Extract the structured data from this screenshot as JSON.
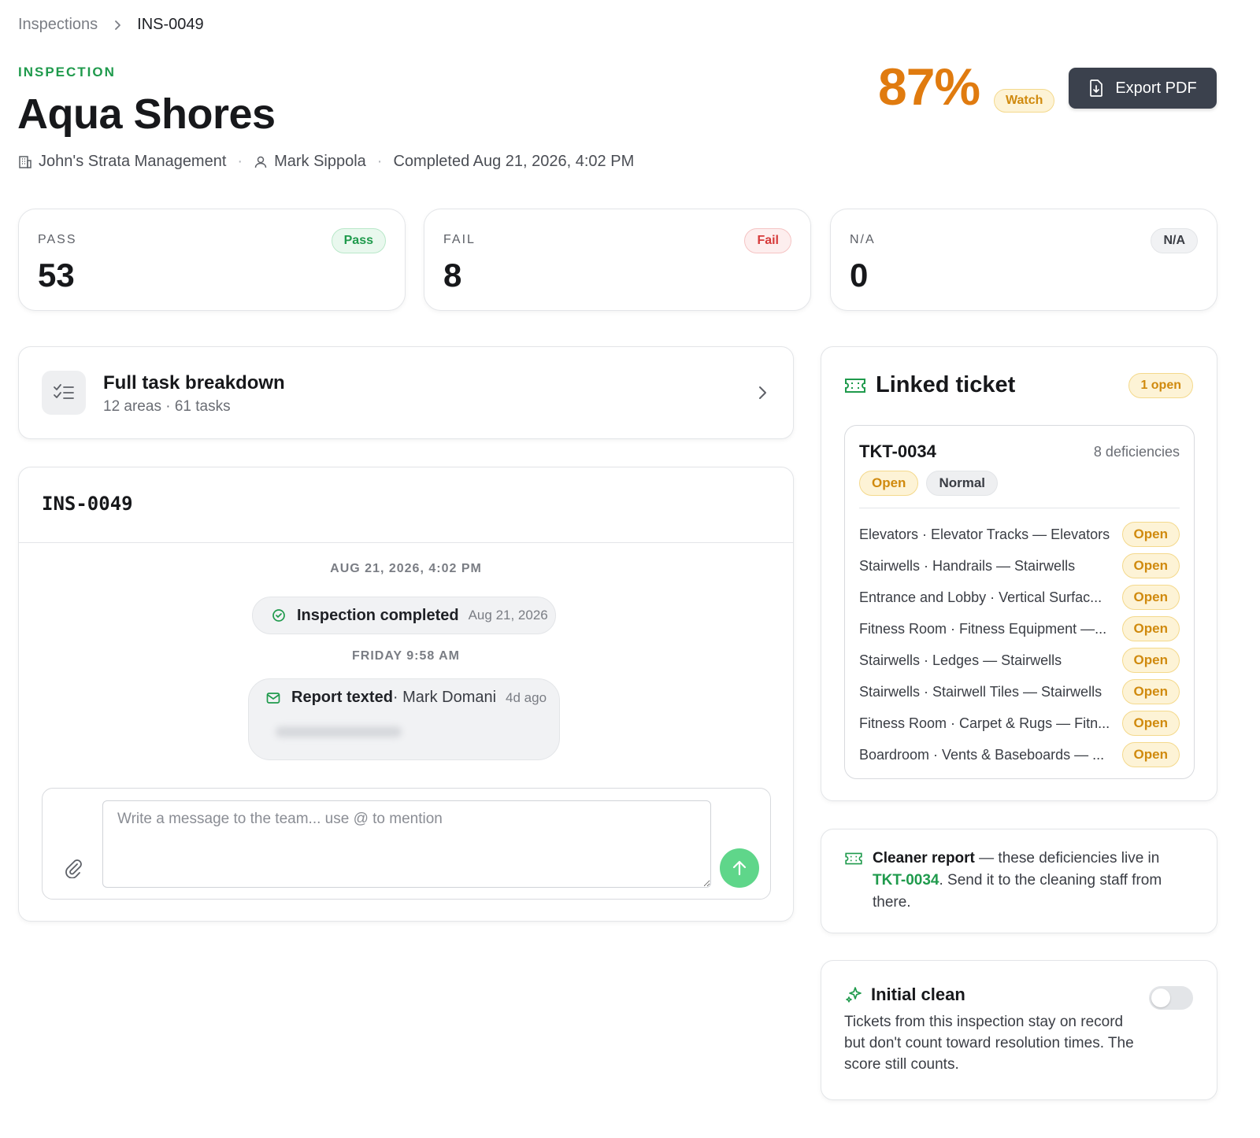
{
  "breadcrumb": {
    "parent": "Inspections",
    "current": "INS-0049"
  },
  "header": {
    "eyebrow": "INSPECTION",
    "title": "Aqua Shores",
    "company": "John's Strata Management",
    "inspector": "Mark Sippola",
    "completed": "Completed Aug 21, 2026, 4:02 PM",
    "score": "87%",
    "score_badge": "Watch",
    "export_label": "Export PDF"
  },
  "stats": [
    {
      "label": "PASS",
      "value": "53",
      "badge": "Pass"
    },
    {
      "label": "FAIL",
      "value": "8",
      "badge": "Fail"
    },
    {
      "label": "N/A",
      "value": "0",
      "badge": "N/A"
    }
  ],
  "breakdown": {
    "title": "Full task breakdown",
    "subtitle": "12 areas · 61 tasks"
  },
  "activity": {
    "id": "INS-0049",
    "day1": "AUG 21, 2026, 4:02 PM",
    "event1": {
      "title": "Inspection completed",
      "date": "Aug 21, 2026"
    },
    "day2": "FRIDAY 9:58 AM",
    "event2": {
      "title": "Report texted",
      "by": "· Mark Domani",
      "ago": "4d ago"
    },
    "composer_placeholder": "Write a message to the team... use @ to mention"
  },
  "linked": {
    "title": "Linked ticket",
    "open_badge": "1 open",
    "ticket": {
      "id": "TKT-0034",
      "count": "8 deficiencies",
      "status": "Open",
      "priority": "Normal",
      "items": [
        {
          "text": "Elevators · Elevator Tracks — Elevators",
          "status": "Open"
        },
        {
          "text": "Stairwells · Handrails — Stairwells",
          "status": "Open"
        },
        {
          "text": "Entrance and Lobby · Vertical Surfac...",
          "status": "Open"
        },
        {
          "text": "Fitness Room · Fitness Equipment —...",
          "status": "Open"
        },
        {
          "text": "Stairwells · Ledges — Stairwells",
          "status": "Open"
        },
        {
          "text": "Stairwells · Stairwell Tiles — Stairwells",
          "status": "Open"
        },
        {
          "text": "Fitness Room · Carpet & Rugs — Fitn...",
          "status": "Open"
        },
        {
          "text": "Boardroom · Vents & Baseboards — ...",
          "status": "Open"
        }
      ]
    }
  },
  "cleaner": {
    "bold": "Cleaner report",
    "before": " — these deficiencies live in ",
    "link": "TKT-0034",
    "after": ". Send it to the cleaning staff from there."
  },
  "initial": {
    "title": "Initial clean",
    "desc": "Tickets from this inspection stay on record but don't count toward resolution times. The score still counts."
  },
  "colors": {
    "accent": "#1f9a4c",
    "score": "#e07b0f",
    "warning_bg": "#fdf3d6",
    "dark_button": "#3b414d"
  }
}
